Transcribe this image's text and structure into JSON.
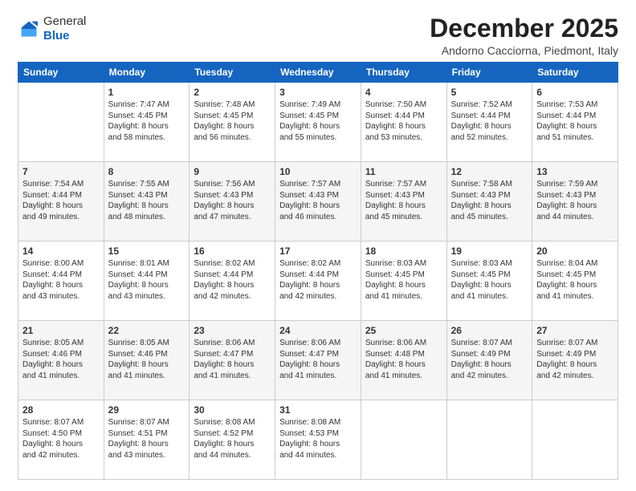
{
  "logo": {
    "general": "General",
    "blue": "Blue"
  },
  "title": "December 2025",
  "subtitle": "Andorno Cacciorna, Piedmont, Italy",
  "days_of_week": [
    "Sunday",
    "Monday",
    "Tuesday",
    "Wednesday",
    "Thursday",
    "Friday",
    "Saturday"
  ],
  "weeks": [
    [
      {
        "day": "",
        "info": ""
      },
      {
        "day": "1",
        "info": "Sunrise: 7:47 AM\nSunset: 4:45 PM\nDaylight: 8 hours\nand 58 minutes."
      },
      {
        "day": "2",
        "info": "Sunrise: 7:48 AM\nSunset: 4:45 PM\nDaylight: 8 hours\nand 56 minutes."
      },
      {
        "day": "3",
        "info": "Sunrise: 7:49 AM\nSunset: 4:45 PM\nDaylight: 8 hours\nand 55 minutes."
      },
      {
        "day": "4",
        "info": "Sunrise: 7:50 AM\nSunset: 4:44 PM\nDaylight: 8 hours\nand 53 minutes."
      },
      {
        "day": "5",
        "info": "Sunrise: 7:52 AM\nSunset: 4:44 PM\nDaylight: 8 hours\nand 52 minutes."
      },
      {
        "day": "6",
        "info": "Sunrise: 7:53 AM\nSunset: 4:44 PM\nDaylight: 8 hours\nand 51 minutes."
      }
    ],
    [
      {
        "day": "7",
        "info": "Sunrise: 7:54 AM\nSunset: 4:44 PM\nDaylight: 8 hours\nand 49 minutes."
      },
      {
        "day": "8",
        "info": "Sunrise: 7:55 AM\nSunset: 4:43 PM\nDaylight: 8 hours\nand 48 minutes."
      },
      {
        "day": "9",
        "info": "Sunrise: 7:56 AM\nSunset: 4:43 PM\nDaylight: 8 hours\nand 47 minutes."
      },
      {
        "day": "10",
        "info": "Sunrise: 7:57 AM\nSunset: 4:43 PM\nDaylight: 8 hours\nand 46 minutes."
      },
      {
        "day": "11",
        "info": "Sunrise: 7:57 AM\nSunset: 4:43 PM\nDaylight: 8 hours\nand 45 minutes."
      },
      {
        "day": "12",
        "info": "Sunrise: 7:58 AM\nSunset: 4:43 PM\nDaylight: 8 hours\nand 45 minutes."
      },
      {
        "day": "13",
        "info": "Sunrise: 7:59 AM\nSunset: 4:43 PM\nDaylight: 8 hours\nand 44 minutes."
      }
    ],
    [
      {
        "day": "14",
        "info": "Sunrise: 8:00 AM\nSunset: 4:44 PM\nDaylight: 8 hours\nand 43 minutes."
      },
      {
        "day": "15",
        "info": "Sunrise: 8:01 AM\nSunset: 4:44 PM\nDaylight: 8 hours\nand 43 minutes."
      },
      {
        "day": "16",
        "info": "Sunrise: 8:02 AM\nSunset: 4:44 PM\nDaylight: 8 hours\nand 42 minutes."
      },
      {
        "day": "17",
        "info": "Sunrise: 8:02 AM\nSunset: 4:44 PM\nDaylight: 8 hours\nand 42 minutes."
      },
      {
        "day": "18",
        "info": "Sunrise: 8:03 AM\nSunset: 4:45 PM\nDaylight: 8 hours\nand 41 minutes."
      },
      {
        "day": "19",
        "info": "Sunrise: 8:03 AM\nSunset: 4:45 PM\nDaylight: 8 hours\nand 41 minutes."
      },
      {
        "day": "20",
        "info": "Sunrise: 8:04 AM\nSunset: 4:45 PM\nDaylight: 8 hours\nand 41 minutes."
      }
    ],
    [
      {
        "day": "21",
        "info": "Sunrise: 8:05 AM\nSunset: 4:46 PM\nDaylight: 8 hours\nand 41 minutes."
      },
      {
        "day": "22",
        "info": "Sunrise: 8:05 AM\nSunset: 4:46 PM\nDaylight: 8 hours\nand 41 minutes."
      },
      {
        "day": "23",
        "info": "Sunrise: 8:06 AM\nSunset: 4:47 PM\nDaylight: 8 hours\nand 41 minutes."
      },
      {
        "day": "24",
        "info": "Sunrise: 8:06 AM\nSunset: 4:47 PM\nDaylight: 8 hours\nand 41 minutes."
      },
      {
        "day": "25",
        "info": "Sunrise: 8:06 AM\nSunset: 4:48 PM\nDaylight: 8 hours\nand 41 minutes."
      },
      {
        "day": "26",
        "info": "Sunrise: 8:07 AM\nSunset: 4:49 PM\nDaylight: 8 hours\nand 42 minutes."
      },
      {
        "day": "27",
        "info": "Sunrise: 8:07 AM\nSunset: 4:49 PM\nDaylight: 8 hours\nand 42 minutes."
      }
    ],
    [
      {
        "day": "28",
        "info": "Sunrise: 8:07 AM\nSunset: 4:50 PM\nDaylight: 8 hours\nand 42 minutes."
      },
      {
        "day": "29",
        "info": "Sunrise: 8:07 AM\nSunset: 4:51 PM\nDaylight: 8 hours\nand 43 minutes."
      },
      {
        "day": "30",
        "info": "Sunrise: 8:08 AM\nSunset: 4:52 PM\nDaylight: 8 hours\nand 44 minutes."
      },
      {
        "day": "31",
        "info": "Sunrise: 8:08 AM\nSunset: 4:53 PM\nDaylight: 8 hours\nand 44 minutes."
      },
      {
        "day": "",
        "info": ""
      },
      {
        "day": "",
        "info": ""
      },
      {
        "day": "",
        "info": ""
      }
    ]
  ]
}
